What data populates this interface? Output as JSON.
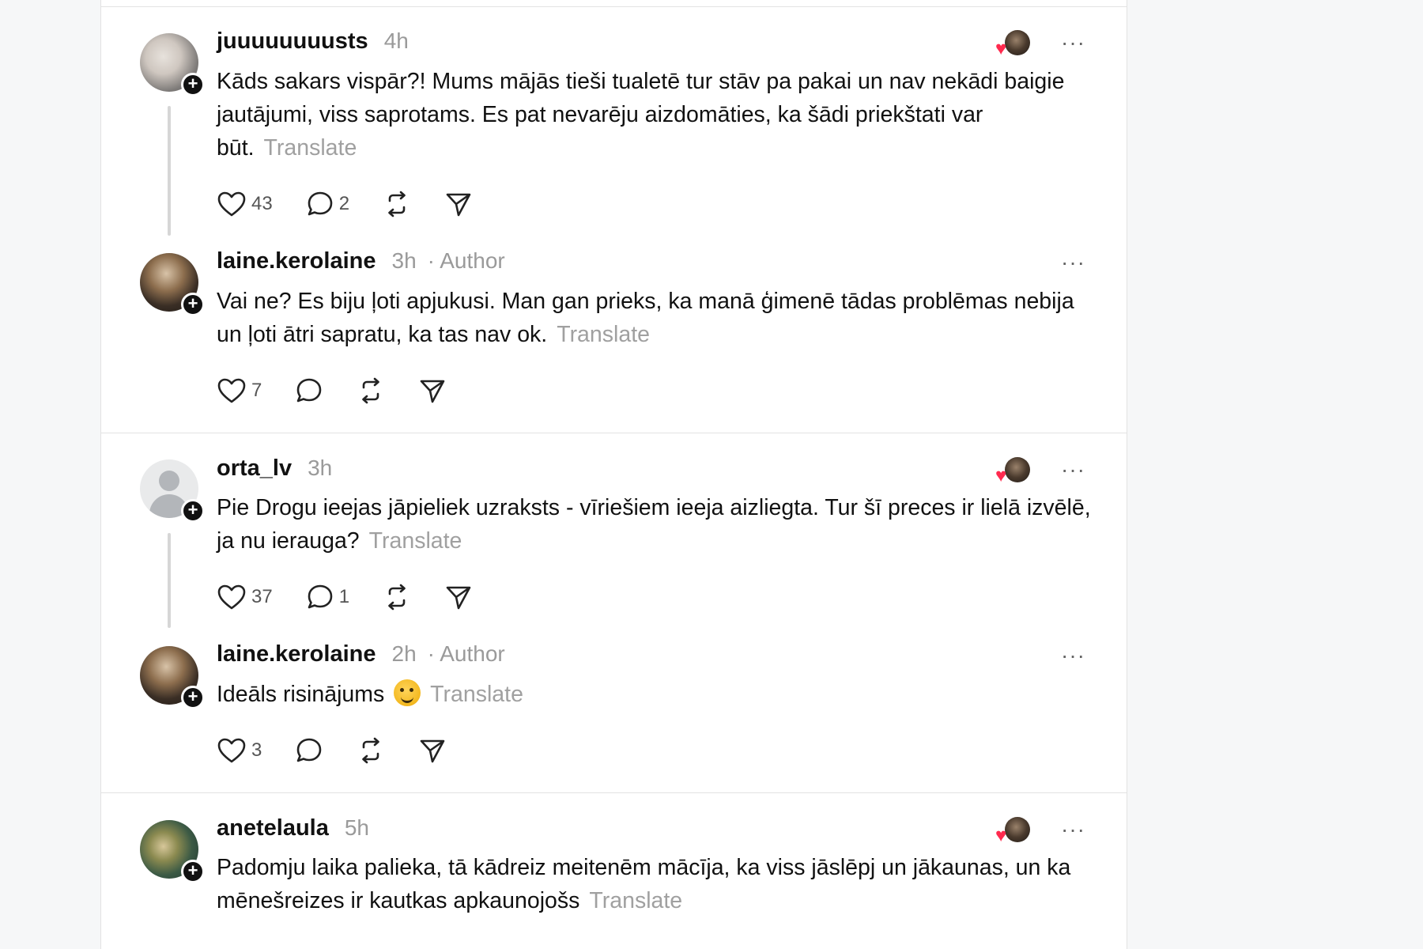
{
  "threads": [
    {
      "comment": {
        "username": "juuuuuuuusts",
        "time": "4h",
        "text": "Kāds sakars vispār?! Mums mājās tieši tualetē tur stāv pa pakai un nav nekādi baigie jautājumi, viss saprotams. Es pat nevarēju aizdomāties, ka šādi priekštati var būt.",
        "translate": "Translate",
        "likes": "43",
        "replies": "2",
        "liked_by_author": true
      },
      "reply": {
        "username": "laine.kerolaine",
        "time": "3h",
        "author_label": "· Author",
        "text": "Vai ne? Es biju ļoti apjukusi. Man gan prieks, ka manā ģimenē tādas problēmas nebija un ļoti ātri sapratu, ka tas nav ok.",
        "translate": "Translate",
        "likes": "7",
        "replies": ""
      }
    },
    {
      "comment": {
        "username": "orta_lv",
        "time": "3h",
        "text": "Pie Drogu ieejas jāpieliek uzraksts - vīriešiem ieeja aizliegta. Tur šī preces ir lielā izvēlē, ja nu ierauga?",
        "translate": "Translate",
        "likes": "37",
        "replies": "1",
        "liked_by_author": true
      },
      "reply": {
        "username": "laine.kerolaine",
        "time": "2h",
        "author_label": "· Author",
        "text": "Ideāls risinājums",
        "translate": "Translate",
        "likes": "3",
        "replies": ""
      }
    },
    {
      "comment": {
        "username": "anetelaula",
        "time": "5h",
        "text": "Padomju laika palieka, tā kādreiz meitenēm mācīja, ka viss jāslēpj un jākaunas, un ka mēnešreizes ir kautkas apkaunojošs",
        "translate": "Translate",
        "liked_by_author": true
      }
    }
  ],
  "icons": {
    "follow": "plus-icon",
    "like": "heart-icon",
    "reply": "speech-bubble-icon",
    "repost": "repost-icon",
    "share": "send-icon",
    "more": "more-icon"
  },
  "colors": {
    "liked_heart": "#ff2a4e",
    "muted": "#9a9a9a"
  },
  "glyphs": {
    "more": "···",
    "plus": "+",
    "heart": "♥"
  }
}
